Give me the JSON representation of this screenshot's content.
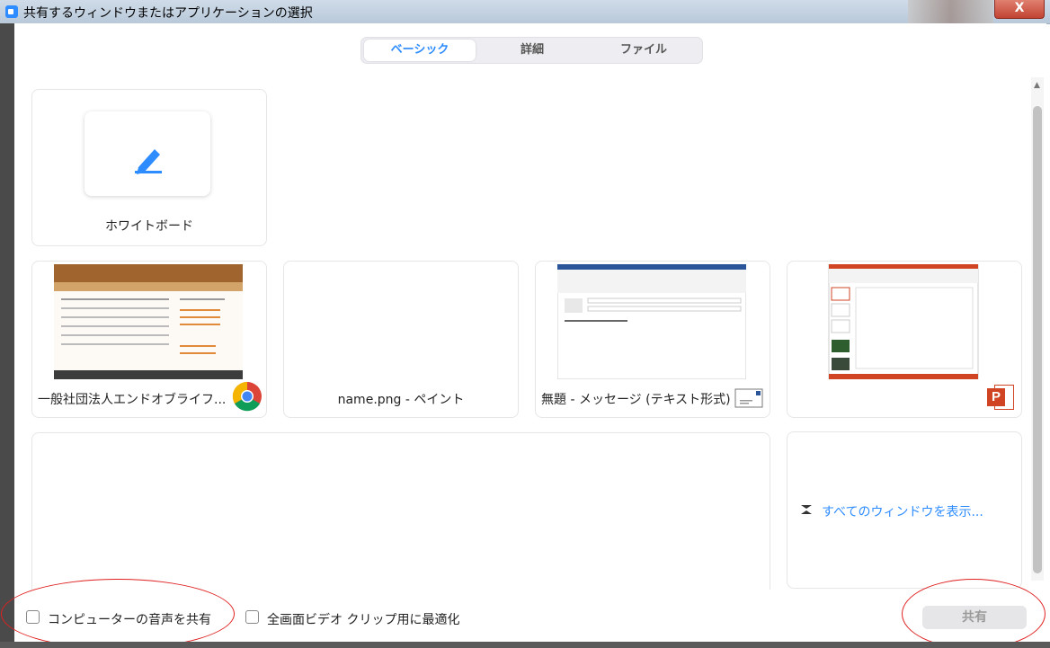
{
  "window": {
    "title": "共有するウィンドウまたはアプリケーションの選択",
    "close_label": "X"
  },
  "tabs": [
    {
      "label": "ベーシック",
      "active": true
    },
    {
      "label": "詳細",
      "active": false
    },
    {
      "label": "ファイル",
      "active": false
    }
  ],
  "whiteboard": {
    "label": "ホワイトボード",
    "icon": "pen-icon"
  },
  "windows": [
    {
      "label": "一般社団法人エンドオブライフ...",
      "app_icon": "chrome-icon"
    },
    {
      "label": "name.png - ペイント"
    },
    {
      "label": "無題 - メッセージ (テキスト形式)",
      "app_icon": "mail-icon"
    },
    {
      "label": "",
      "app_icon": "powerpoint-icon",
      "app_icon_text": "P"
    }
  ],
  "show_all": {
    "label": "すべてのウィンドウを表示..."
  },
  "options": {
    "share_audio": {
      "label": "コンピューターの音声を共有",
      "checked": false
    },
    "optimize_video": {
      "label": "全画面ビデオ クリップ用に最適化",
      "checked": false
    }
  },
  "share_button": {
    "label": "共有"
  },
  "colors": {
    "accent": "#2d8cff",
    "annotation": "#e02020",
    "powerpoint": "#d04423"
  }
}
